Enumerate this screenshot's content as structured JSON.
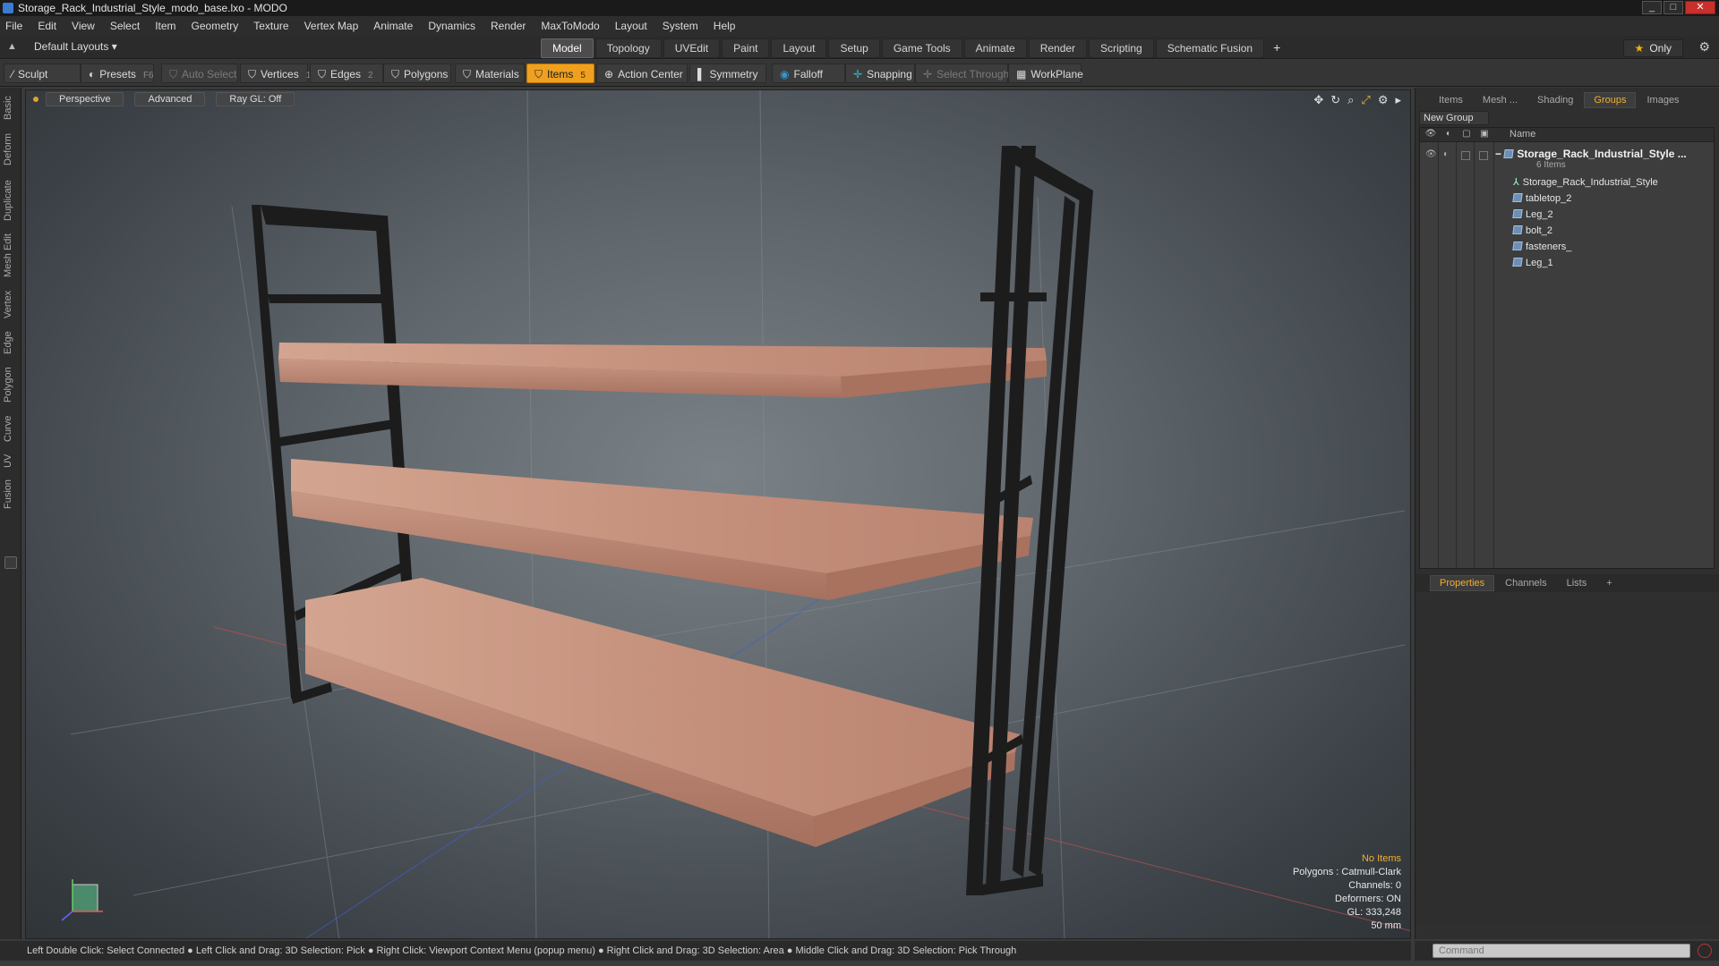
{
  "window": {
    "title": "Storage_Rack_Industrial_Style_modo_base.lxo - MODO",
    "buttons": [
      "_",
      "□",
      "✕"
    ]
  },
  "menu": [
    "File",
    "Edit",
    "View",
    "Select",
    "Item",
    "Geometry",
    "Texture",
    "Vertex Map",
    "Animate",
    "Dynamics",
    "Render",
    "MaxToModo",
    "Layout",
    "System",
    "Help"
  ],
  "layout": {
    "default_layouts": "Default Layouts ▾",
    "tabs": [
      "Model",
      "Topology",
      "UVEdit",
      "Paint",
      "Layout",
      "Setup",
      "Game Tools",
      "Animate",
      "Render",
      "Scripting",
      "Schematic Fusion"
    ],
    "active_tab": "Model",
    "add": "+",
    "only": "Only"
  },
  "toolbar": {
    "sculpt": "Sculpt",
    "presets": "Presets",
    "presets_key": "F6",
    "auto_select": "Auto Select",
    "vertices": "Vertices",
    "vertices_key": "1",
    "edges": "Edges",
    "edges_key": "2",
    "polygons": "Polygons",
    "materials": "Materials",
    "items": "Items",
    "items_key": "5",
    "action_center": "Action Center",
    "symmetry": "Symmetry",
    "falloff": "Falloff",
    "snapping": "Snapping",
    "select_through": "Select Through",
    "workplane": "WorkPlane"
  },
  "left_tabs": [
    "Basic",
    "Deform",
    "Duplicate",
    "Mesh Edit",
    "Vertex",
    "Edge",
    "Polygon",
    "Curve",
    "UV",
    "Fusion"
  ],
  "viewport": {
    "perspective": "Perspective",
    "advanced": "Advanced",
    "raygl": "Ray GL: Off",
    "info": {
      "no_items": "No Items",
      "polygons": "Polygons : Catmull-Clark",
      "channels": "Channels: 0",
      "deformers": "Deformers: ON",
      "gl": "GL: 333,248",
      "scale": "50 mm"
    }
  },
  "status": "Left Double Click: Select Connected ● Left Click and Drag: 3D Selection: Pick ● Right Click: Viewport Context Menu (popup menu) ● Right Click and Drag: 3D Selection: Area ● Middle Click and Drag: 3D Selection: Pick Through",
  "right_panel": {
    "tabs": [
      "Items",
      "Mesh ...",
      "Shading",
      "Groups",
      "Images"
    ],
    "active_tab": "Groups",
    "new_group": "New Group",
    "name_header": "Name",
    "group": {
      "name": "Storage_Rack_Industrial_Style ...",
      "count": "6 Items"
    },
    "items": [
      "Storage_Rack_Industrial_Style",
      "tabletop_2",
      "Leg_2",
      "bolt_2",
      "fasteners_",
      "Leg_1"
    ],
    "props_tabs": [
      "Properties",
      "Channels",
      "Lists"
    ],
    "props_active": "Properties",
    "props_add": "+",
    "command_placeholder": "Command"
  },
  "colors": {
    "accent": "#f0a020",
    "viewport_bg": "#5e656b",
    "wood": "#b57f6b",
    "metal": "#1c1c1c"
  }
}
